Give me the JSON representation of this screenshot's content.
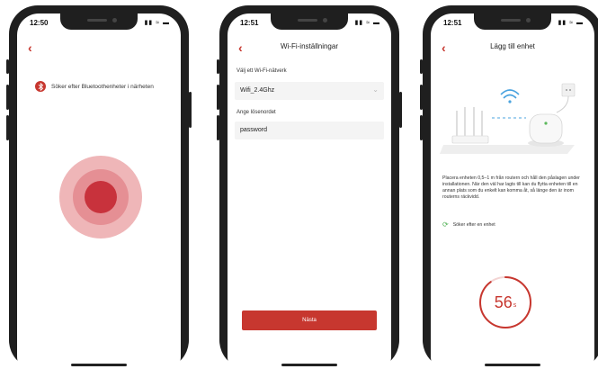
{
  "screen1": {
    "time": "12:50",
    "status_icons": "▮▮ ≈ ▬",
    "back": "‹",
    "bt_status": "Söker efter Bluetoothenheter i närheten",
    "bt_icon": "bluetooth-icon"
  },
  "screen2": {
    "time": "12:51",
    "status_icons": "▮▮ ≈ ▬",
    "back": "‹",
    "title": "Wi-Fi-inställningar",
    "network_label": "Välj ett Wi-Fi-nätverk",
    "network_value": "Wifi_2.4Ghz",
    "password_label": "Ange lösenordet",
    "password_value": "password",
    "next_label": "Nästa"
  },
  "screen3": {
    "time": "12:51",
    "status_icons": "▮▮ ≈ ▬",
    "back": "‹",
    "title": "Lägg till enhet",
    "description": "Placera enheten 0,5–1 m från routern och håll den påslagen under installationen. När den väl har lagts till kan du flytta enheten till en annan plats som du enkelt kan komma åt, så länge den är inom routerns räckvidd.",
    "searching": "Söker efter en enhet",
    "countdown": "56",
    "countdown_unit": "s",
    "countdown_progress": 0.9
  },
  "colors": {
    "accent": "#c7372f",
    "radar_outer": "#efb6b8",
    "radar_mid": "#e58f94",
    "radar_inner": "#c8323c",
    "spinner": "#4caf50"
  }
}
